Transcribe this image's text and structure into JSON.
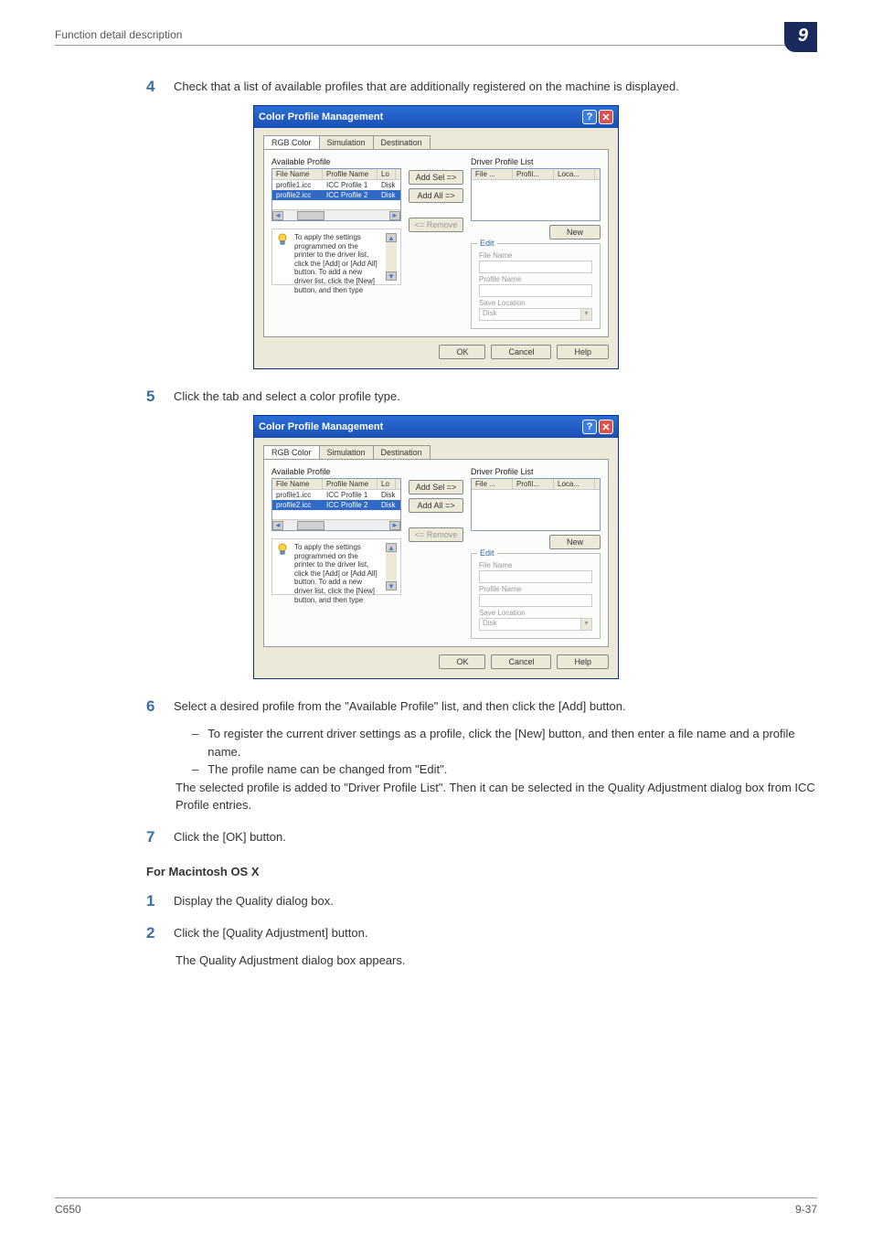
{
  "header": {
    "label": "Function detail description",
    "section_number": "9"
  },
  "steps": {
    "s4": {
      "num": "4",
      "text": "Check that a list of available profiles that are additionally registered on the machine is displayed."
    },
    "s5": {
      "num": "5",
      "text": "Click the tab and select a color profile type."
    },
    "s6": {
      "num": "6",
      "text": "Select a desired profile from the \"Available Profile\" list, and then click the [Add] button."
    },
    "s6_dash1": "To register the current driver settings as a profile, click the [New] button, and then enter a file name and a profile name.",
    "s6_dash2": "The profile name can be changed from \"Edit\".",
    "s6_after1": "The selected profile is added to \"Driver Profile List\". Then it can be selected in the Quality Adjustment dialog box from ICC Profile entries.",
    "s7": {
      "num": "7",
      "text": "Click the [OK] button."
    }
  },
  "mac": {
    "heading": "For Macintosh OS X",
    "s1": {
      "num": "1",
      "text": "Display the Quality dialog box."
    },
    "s2": {
      "num": "2",
      "text": "Click the [Quality Adjustment] button."
    },
    "s2_after": "The Quality Adjustment dialog box appears."
  },
  "dialog": {
    "title": "Color Profile Management",
    "tabs": {
      "rgb": "RGB Color",
      "sim": "Simulation",
      "dest": "Destination"
    },
    "left_label": "Available Profile",
    "right_label": "Driver Profile List",
    "listhead_left": {
      "c1": "File Name",
      "c2": "Profile Name",
      "c3": "Lo"
    },
    "listhead_right": {
      "c1": "File ...",
      "c2": "Profil...",
      "c3": "Loca..."
    },
    "row1": {
      "c1": "profile1.icc",
      "c2": "ICC Profile 1",
      "c3": "Disk"
    },
    "row2": {
      "c1": "profile2.icc",
      "c2": "ICC Profile 2",
      "c3": "Disk"
    },
    "buttons": {
      "add_sel": "Add Sel =>",
      "add_all": "Add All =>",
      "remove": "<= Remove",
      "new": "New"
    },
    "hint_text": "To apply the settings programmed on the printer to the driver list, click the [Add] or [Add All] button. To add a new driver list, click the [New] button, and then type",
    "edit": {
      "legend": "Edit",
      "file_name": "File Name",
      "profile_name": "Profile Name",
      "save_location": "Save Location",
      "disk": "Disk"
    },
    "actions": {
      "ok": "OK",
      "cancel": "Cancel",
      "help": "Help"
    }
  },
  "footer": {
    "left": "C650",
    "right": "9-37"
  }
}
